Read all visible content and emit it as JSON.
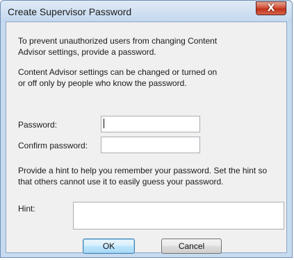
{
  "window": {
    "title": "Create Supervisor Password",
    "close_glyph": "X"
  },
  "intro": {
    "line1": "To prevent unauthorized users from changing Content",
    "line2": "Advisor settings, provide a password.",
    "line3": "Content Advisor settings can be changed or turned on",
    "line4": "or off only by people who know the password."
  },
  "password": {
    "label": "Password:",
    "value": ""
  },
  "confirm": {
    "label": "Confirm password:",
    "value": ""
  },
  "hint_text": {
    "line1": "Provide a hint to help you remember your password. Set the hint so",
    "line2": "that others cannot use it to easily guess your password."
  },
  "hint": {
    "label": "Hint:",
    "value": ""
  },
  "buttons": {
    "ok": "OK",
    "cancel": "Cancel"
  },
  "icons": {
    "close": "close-icon"
  }
}
